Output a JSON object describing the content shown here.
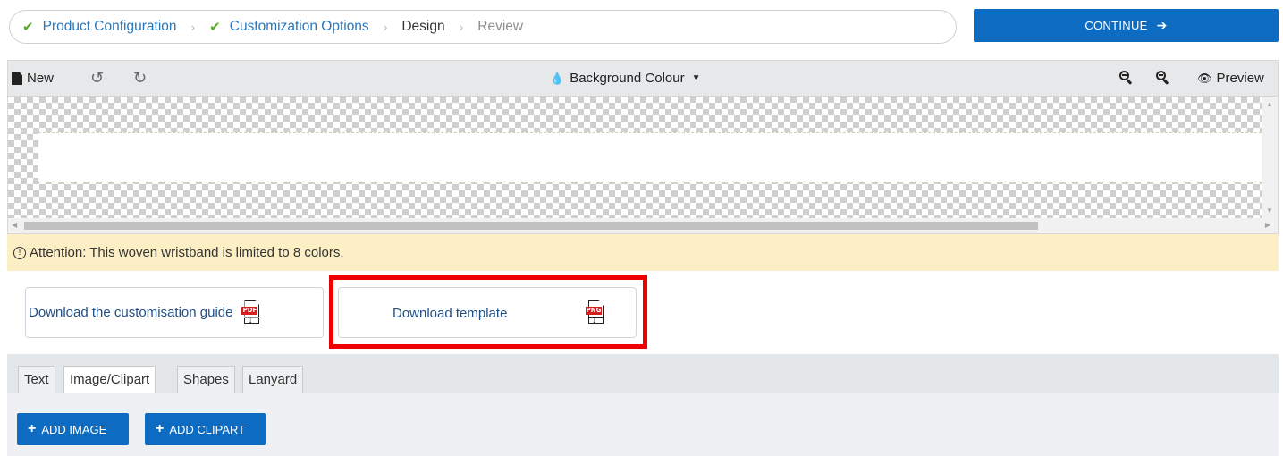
{
  "breadcrumb": {
    "steps": [
      {
        "label": "Product Configuration",
        "state": "done"
      },
      {
        "label": "Customization Options",
        "state": "done"
      },
      {
        "label": "Design",
        "state": "current"
      },
      {
        "label": "Review",
        "state": "todo"
      }
    ]
  },
  "continue_button": {
    "label": "CONTINUE"
  },
  "toolbar": {
    "new_label": "New",
    "background_label": "Background Colour",
    "preview_label": "Preview"
  },
  "attention": {
    "text": "Attention: This woven wristband is limited to 8 colors."
  },
  "downloads": {
    "guide_label": "Download the customisation guide",
    "guide_file_type": "PDF",
    "template_label": "Download template",
    "template_file_type": "PNG"
  },
  "tabs": [
    {
      "label": "Text"
    },
    {
      "label": "Image/Clipart",
      "active": true
    },
    {
      "label": "Shapes"
    },
    {
      "label": "Lanyard"
    }
  ],
  "actions": {
    "add_image_label": "ADD IMAGE",
    "add_clipart_label": "ADD CLIPART"
  },
  "colors": {
    "primary": "#0d6cc2",
    "check": "#5aab2c",
    "link": "#2a76b8",
    "attention_bg": "#fcefc6",
    "highlight": "#ee0000"
  }
}
